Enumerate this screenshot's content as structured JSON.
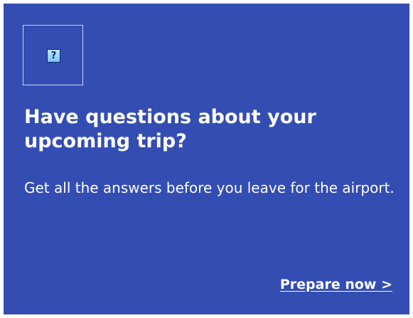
{
  "card": {
    "background_color": "#334db3",
    "icon": "help-question-icon",
    "icon_glyph": "?",
    "title": "Have questions about your upcoming trip?",
    "description": "Get all the answers before you leave for the airport.",
    "cta_label": "Prepare now >"
  }
}
